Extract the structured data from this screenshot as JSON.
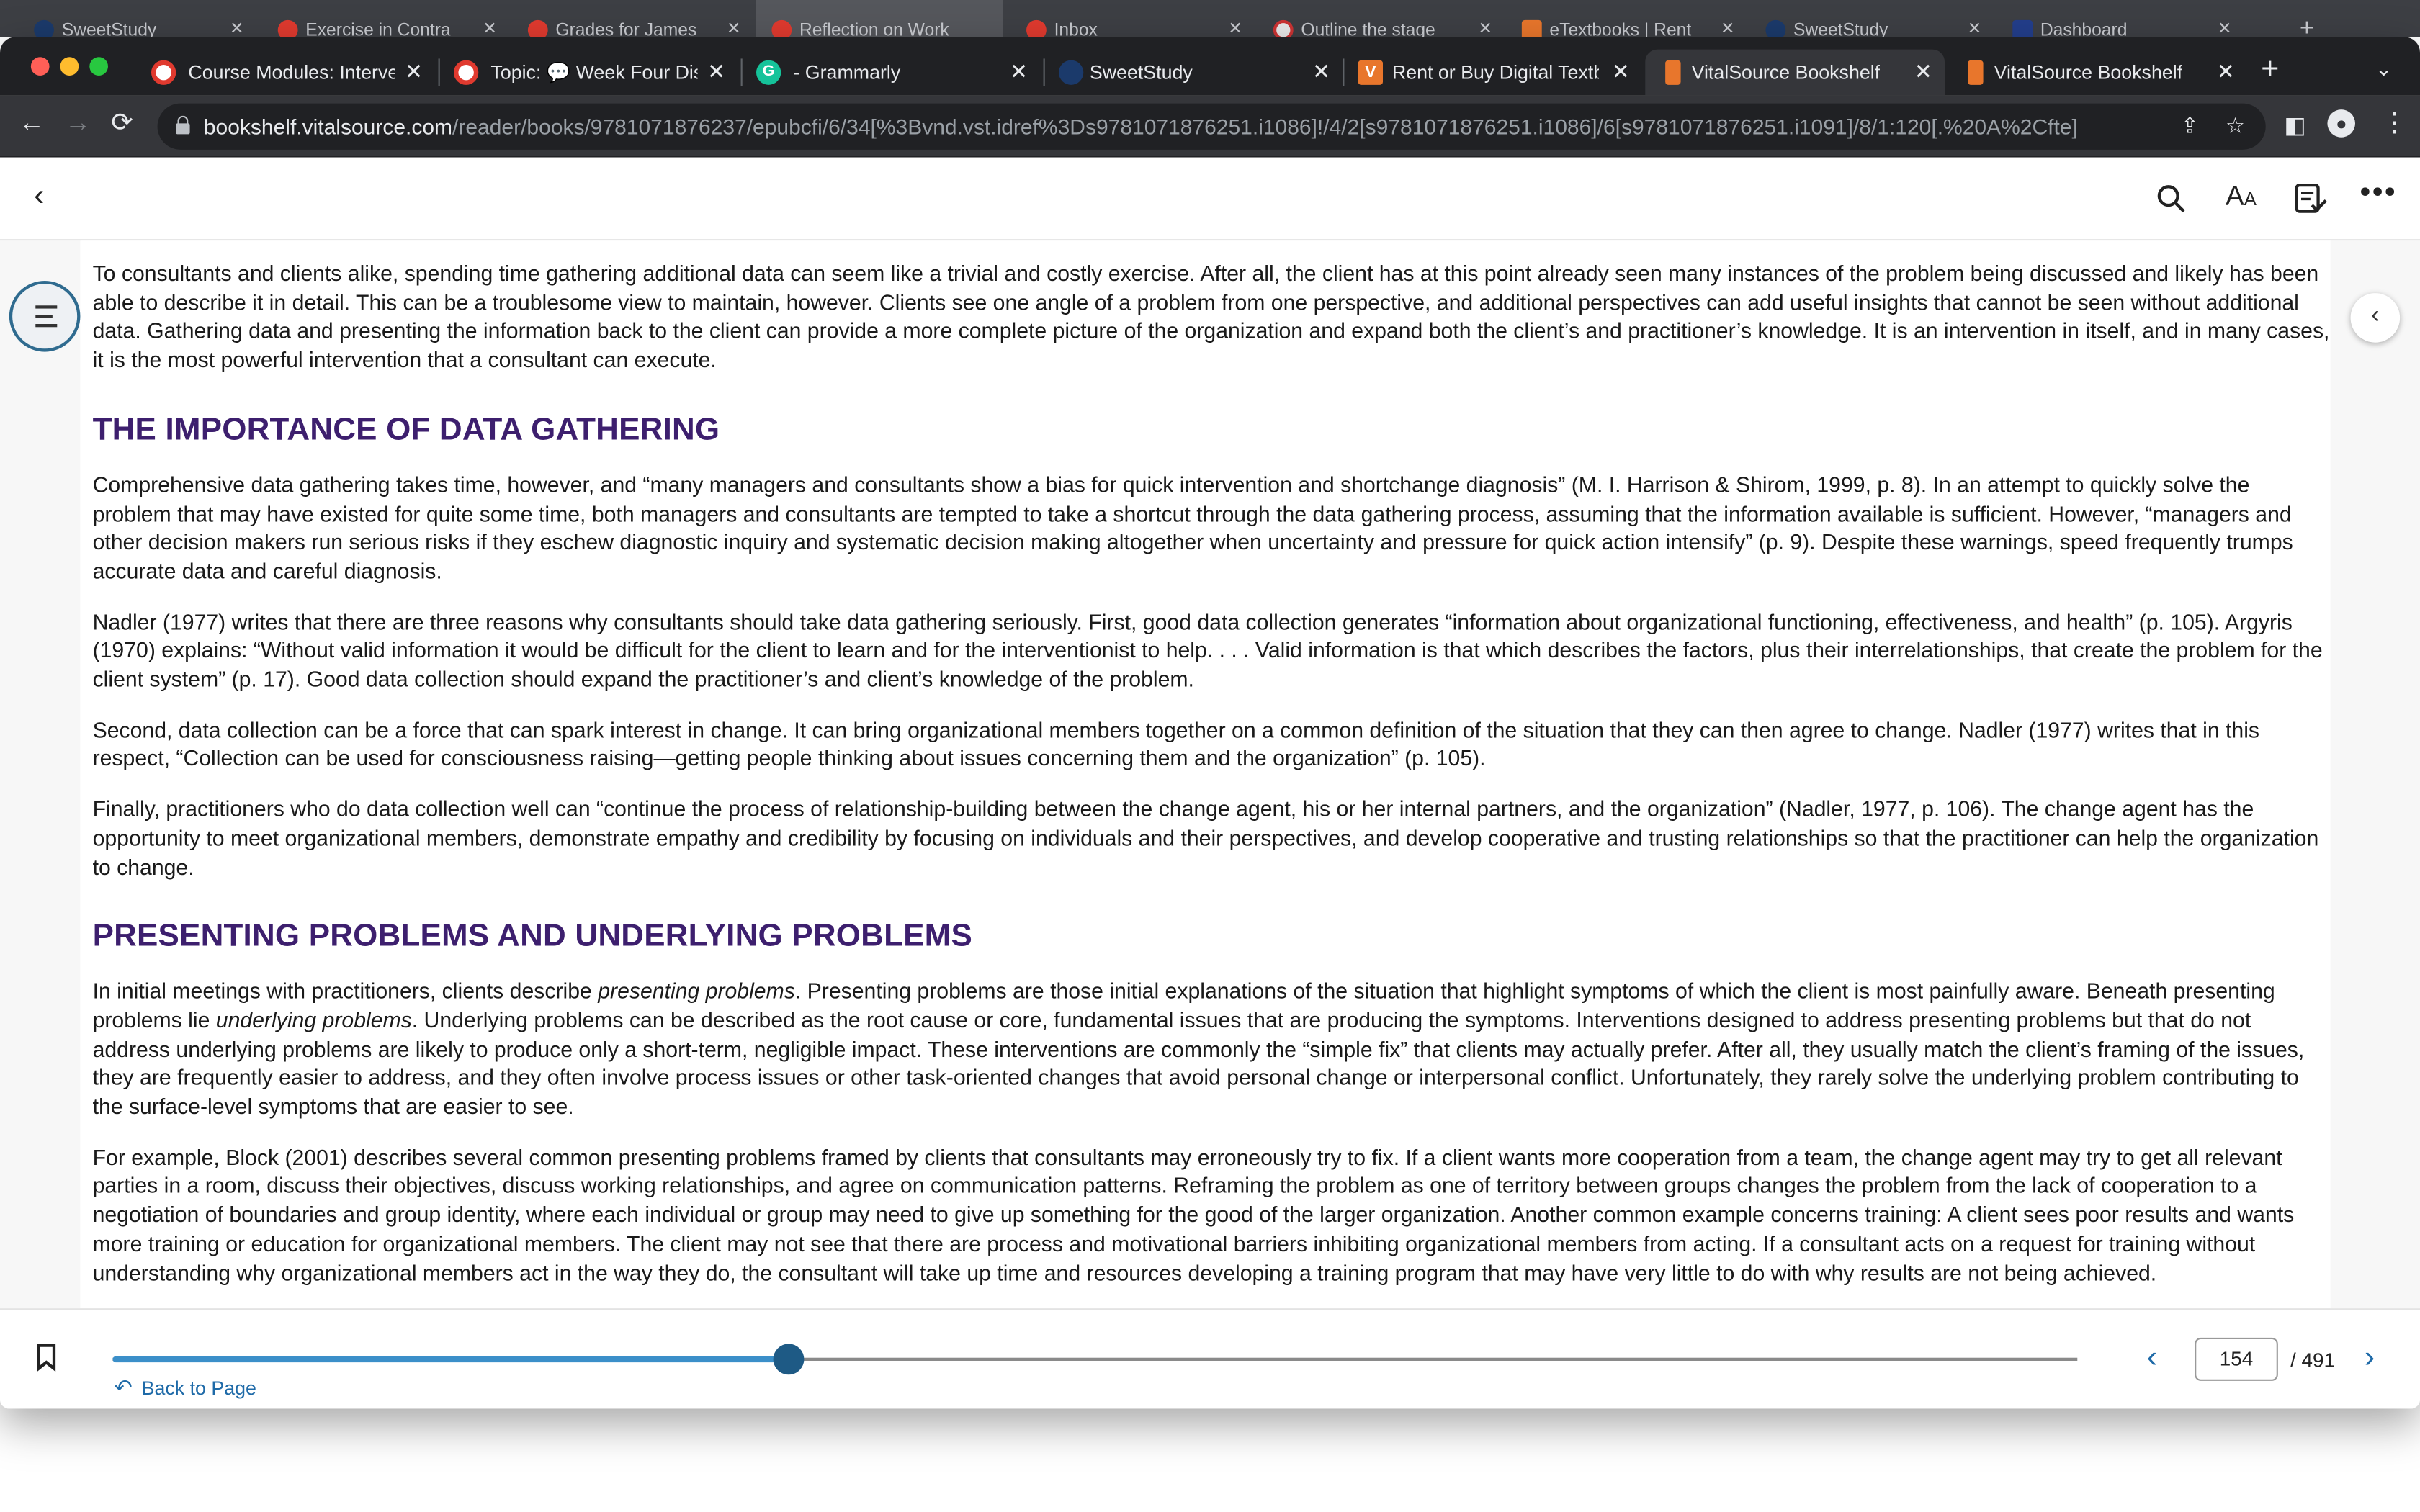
{
  "back_tabs": [
    "SweetStudy",
    "Exercise in Contra",
    "Grades for James",
    "Reflection on Work",
    "Inbox",
    "Outline the stage",
    "eTextbooks | Rent",
    "SweetStudy",
    "Dashboard"
  ],
  "tabs": [
    {
      "label": "Course Modules: Interven",
      "icon": "canvas-icon",
      "color": "#e03a2f"
    },
    {
      "label": "Topic: 💬 Week Four Disc",
      "icon": "canvas-icon",
      "color": "#e03a2f"
    },
    {
      "label": "- Grammarly",
      "icon": "grammarly-icon",
      "color": "#15c39a"
    },
    {
      "label": "SweetStudy",
      "icon": "sweetstudy-icon",
      "color": "#1b3a6b"
    },
    {
      "label": "Rent or Buy Digital Textbo",
      "icon": "vitalsource-icon",
      "color": "#e8762c"
    },
    {
      "label": "VitalSource Bookshelf: On",
      "icon": "bookshelf-icon",
      "color": "#e8762c"
    },
    {
      "label": "VitalSource Bookshelf: Lib",
      "icon": "bookshelf-icon",
      "color": "#e8762c"
    }
  ],
  "address": {
    "host": "bookshelf.vitalsource.com",
    "path": "/reader/books/9781071876237/epubcfi/6/34[%3Bvnd.vst.idref%3Ds9781071876251.i1086]!/4/2[s9781071876251.i1086]/6[s9781071876251.i1091]/8/1:120[.%20A%2Cfte]"
  },
  "content": {
    "p0": "To consultants and clients alike, spending time gathering additional data can seem like a trivial and costly exercise. After all, the client has at this point already seen many instances of the problem being discussed and likely has been able to describe it in detail. This can be a troublesome view to maintain, however. Clients see one angle of a problem from one perspective, and additional perspectives can add useful insights that cannot be seen without additional data. Gathering data and presenting the information back to the client can provide a more complete picture of the organization and expand both the client’s and practitioner’s knowledge. It is an intervention in itself, and in many cases, it is the most powerful intervention that a consultant can execute.",
    "h1": "THE IMPORTANCE OF DATA GATHERING",
    "p1": "Comprehensive data gathering takes time, however, and “many managers and consultants show a bias for quick intervention and shortchange diagnosis” (M. I. Harrison & Shirom, 1999, p. 8). In an attempt to quickly solve the problem that may have existed for quite some time, both managers and consultants are tempted to take a shortcut through the data gathering process, assuming that the information available is sufficient. However, “managers and other decision makers run serious risks if they eschew diagnostic inquiry and systematic decision making altogether when uncertainty and pressure for quick action intensify” (p. 9). Despite these warnings, speed frequently trumps accurate data and careful diagnosis.",
    "p2": "Nadler (1977) writes that there are three reasons why consultants should take data gathering seriously. First, good data collection generates “information about organizational functioning, effectiveness, and health” (p. 105). Argyris (1970) explains: “Without valid information it would be difficult for the client to learn and for the interventionist to help. . . . Valid information is that which describes the factors, plus their interrelationships, that create the problem for the client system” (p. 17). Good data collection should expand the practitioner’s and client’s knowledge of the problem.",
    "p3": "Second, data collection can be a force that can spark interest in change. It can bring organizational members together on a common definition of the situation that they can then agree to change. Nadler (1977) writes that in this respect, “Collection can be used for consciousness raising—getting people thinking about issues concerning them and the organization” (p. 105).",
    "p4": "Finally, practitioners who do data collection well can “continue the process of relationship-building between the change agent, his or her internal partners, and the organization” (Nadler, 1977, p. 106). The change agent has the opportunity to meet organizational members, demonstrate empathy and credibility by focusing on individuals and their perspectives, and develop cooperative and trusting relationships so that the practitioner can help the organization to change.",
    "h2": "PRESENTING PROBLEMS AND UNDERLYING PROBLEMS",
    "p5": {
      "a": "In initial meetings with practitioners, clients describe ",
      "i1": "presenting problems",
      "b": ". Presenting problems are those initial explanations of the situation that highlight symptoms of which the client is most painfully aware. Beneath presenting problems lie ",
      "i2": "underlying problems",
      "c": ". Underlying problems can be described as the root cause or core, fundamental issues that are producing the symptoms. Interventions designed to address presenting problems but that do not address underlying problems are likely to produce only a short-term, negligible impact. These interventions are commonly the “simple fix” that clients may actually prefer. After all, they usually match the client’s framing of the issues, they are frequently easier to address, and they often involve process issues or other task-oriented changes that avoid personal change or interpersonal conflict. Unfortunately, they rarely solve the underlying problem contributing to the surface-level symptoms that are easier to see."
    },
    "p6": "For example, Block (2001) describes several common presenting problems framed by clients that consultants may erroneously try to fix. If a client wants more cooperation from a team, the change agent may try to get all relevant parties in a room, discuss their objectives, discuss working relationships, and agree on communication patterns. Reframing the problem as one of territory between groups changes the problem from the lack of cooperation to a negotiation of boundaries and group identity, where each individual or group may need to give up something for the good of the larger organization. Another common example concerns training: A client sees poor results and wants more training or education for organizational members. The client may not see that there are process and motivational barriers inhibiting organizational members from acting. If a consultant acts on a request for training without understanding why organizational members act in the way they do, the consultant will take up time and resources developing a training program that may have very little to do with why results are not being achieved."
  },
  "footer": {
    "back_to_page": "Back to Page",
    "current_page": "154",
    "total_pages": "/ 491",
    "progress": 0.344
  },
  "colors": {
    "heading": "#3d1f6e",
    "accent": "#3b8fc9",
    "thumb": "#1e5a85",
    "link": "#1e6aa8"
  }
}
